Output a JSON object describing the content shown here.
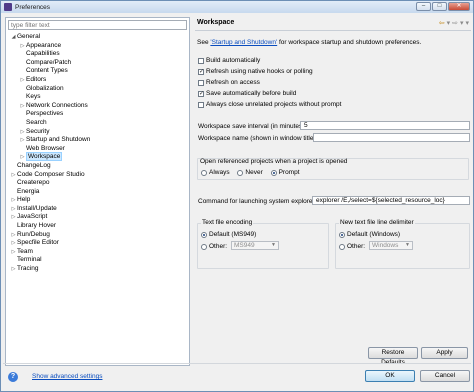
{
  "window": {
    "title": "Preferences"
  },
  "filter": {
    "placeholder": "type filter text"
  },
  "tree": [
    {
      "label": "General",
      "depth": 0,
      "arrow": "expanded"
    },
    {
      "label": "Appearance",
      "depth": 1,
      "arrow": "collapsed"
    },
    {
      "label": "Capabilities",
      "depth": 1,
      "arrow": ""
    },
    {
      "label": "Compare/Patch",
      "depth": 1,
      "arrow": ""
    },
    {
      "label": "Content Types",
      "depth": 1,
      "arrow": ""
    },
    {
      "label": "Editors",
      "depth": 1,
      "arrow": "collapsed"
    },
    {
      "label": "Globalization",
      "depth": 1,
      "arrow": ""
    },
    {
      "label": "Keys",
      "depth": 1,
      "arrow": ""
    },
    {
      "label": "Network Connections",
      "depth": 1,
      "arrow": "collapsed"
    },
    {
      "label": "Perspectives",
      "depth": 1,
      "arrow": ""
    },
    {
      "label": "Search",
      "depth": 1,
      "arrow": ""
    },
    {
      "label": "Security",
      "depth": 1,
      "arrow": "collapsed"
    },
    {
      "label": "Startup and Shutdown",
      "depth": 1,
      "arrow": "collapsed"
    },
    {
      "label": "Web Browser",
      "depth": 1,
      "arrow": ""
    },
    {
      "label": "Workspace",
      "depth": 1,
      "arrow": "collapsed",
      "selected": true
    },
    {
      "label": "ChangeLog",
      "depth": 0,
      "arrow": ""
    },
    {
      "label": "Code Composer Studio",
      "depth": 0,
      "arrow": "collapsed"
    },
    {
      "label": "Createrepo",
      "depth": 0,
      "arrow": ""
    },
    {
      "label": "Energia",
      "depth": 0,
      "arrow": ""
    },
    {
      "label": "Help",
      "depth": 0,
      "arrow": "collapsed"
    },
    {
      "label": "Install/Update",
      "depth": 0,
      "arrow": "collapsed"
    },
    {
      "label": "JavaScript",
      "depth": 0,
      "arrow": "collapsed"
    },
    {
      "label": "Library Hover",
      "depth": 0,
      "arrow": ""
    },
    {
      "label": "Run/Debug",
      "depth": 0,
      "arrow": "collapsed"
    },
    {
      "label": "Specfile Editor",
      "depth": 0,
      "arrow": "collapsed"
    },
    {
      "label": "Team",
      "depth": 0,
      "arrow": "collapsed"
    },
    {
      "label": "Terminal",
      "depth": 0,
      "arrow": ""
    },
    {
      "label": "Tracing",
      "depth": 0,
      "arrow": "collapsed"
    }
  ],
  "page": {
    "title": "Workspace",
    "see_prefix": "See ",
    "see_link": "'Startup and Shutdown'",
    "see_suffix": " for workspace startup and shutdown preferences.",
    "checkboxes": [
      {
        "label": "Build automatically",
        "checked": false
      },
      {
        "label": "Refresh using native hooks or polling",
        "checked": true
      },
      {
        "label": "Refresh on access",
        "checked": false
      },
      {
        "label": "Save automatically before build",
        "checked": true
      },
      {
        "label": "Always close unrelated projects without prompt",
        "checked": false
      }
    ],
    "save_interval_label": "Workspace save interval (in minutes):",
    "save_interval_value": "5",
    "workspace_name_label": "Workspace name (shown in window title):",
    "workspace_name_value": "",
    "open_ref_label": "Open referenced projects when a project is opened",
    "open_ref_options": [
      {
        "label": "Always",
        "selected": false
      },
      {
        "label": "Never",
        "selected": false
      },
      {
        "label": "Prompt",
        "selected": true
      }
    ],
    "command_label": "Command for launching system explorer:",
    "command_value": "explorer /E,/select=${selected_resource_loc}",
    "encoding_group": {
      "title": "Text file encoding",
      "default_label": "Default (MS949)",
      "other_label": "Other:",
      "other_value": "MS949"
    },
    "delimiter_group": {
      "title": "New text file line delimiter",
      "default_label": "Default (Windows)",
      "other_label": "Other:",
      "other_value": "Windows"
    },
    "restore_defaults": "Restore Defaults",
    "apply": "Apply"
  },
  "footer": {
    "show_advanced": "Show advanced settings",
    "ok": "OK",
    "cancel": "Cancel"
  },
  "colors": {
    "link": "#0a4dbf",
    "selection": "#cde8ff"
  },
  "icons": [
    "help-icon",
    "back-arrow-icon",
    "forward-arrow-icon",
    "menu-icon"
  ]
}
